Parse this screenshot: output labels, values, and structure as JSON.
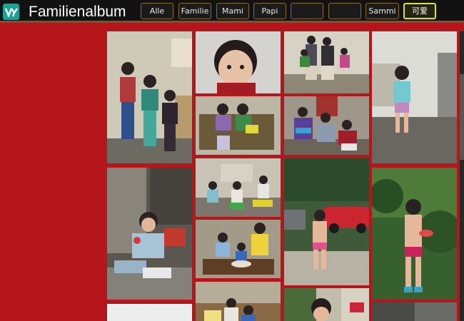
{
  "app": {
    "title": "Familienalbum",
    "logo": "vy-logo-icon",
    "accent": "#16a39a"
  },
  "filters": [
    {
      "label": "Alle"
    },
    {
      "label": "Familie"
    },
    {
      "label": "Mami"
    },
    {
      "label": "Papi"
    },
    {
      "label": ""
    },
    {
      "label": ""
    },
    {
      "label": "Sammi"
    },
    {
      "label": "可爱",
      "active": true
    }
  ],
  "colors": {
    "background": "#b5161b",
    "topbar": "#121212",
    "button_border": "#8a6a30",
    "active_border": "#d9e04a"
  }
}
